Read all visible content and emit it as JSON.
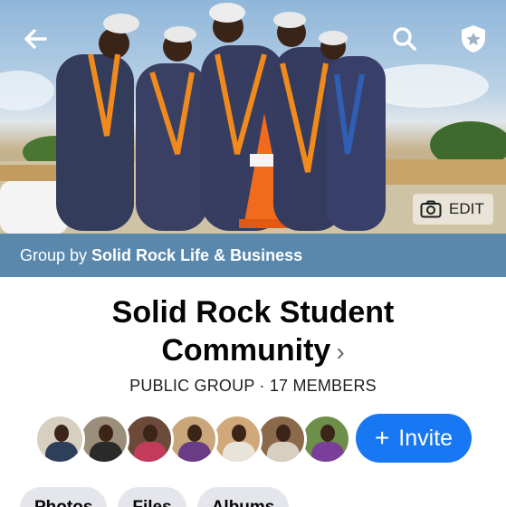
{
  "header": {
    "back_icon": "arrow-left-icon",
    "search_icon": "search-icon",
    "admin_icon": "shield-star-icon",
    "edit_label": "EDIT",
    "edit_icon": "camera-icon"
  },
  "group": {
    "by_prefix": "Group by",
    "owner": "Solid Rock Life & Business",
    "title_line1": "Solid Rock Student",
    "title_line2": "Community",
    "privacy": "PUBLIC GROUP",
    "separator": "·",
    "members_count": "17 MEMBERS"
  },
  "members": {
    "avatars": [
      {
        "body": "#2e3f5c",
        "bg": "#d7cfbf"
      },
      {
        "body": "#2a2a2a",
        "bg": "#9b8f7b"
      },
      {
        "body": "#c23b5a",
        "bg": "#6b4a3a"
      },
      {
        "body": "#6a3c86",
        "bg": "#c9a77a"
      },
      {
        "body": "#e9e4da",
        "bg": "#d1a87a"
      },
      {
        "body": "#d8cfc0",
        "bg": "#8a6a4a"
      },
      {
        "body": "#7a3f9a",
        "bg": "#6e8f4a"
      }
    ],
    "invite_label": "Invite",
    "invite_icon": "plus-icon"
  },
  "tabs": [
    "Photos",
    "Files",
    "Albums"
  ],
  "colors": {
    "accent": "#1877f2",
    "banner": "#5a88ad"
  }
}
